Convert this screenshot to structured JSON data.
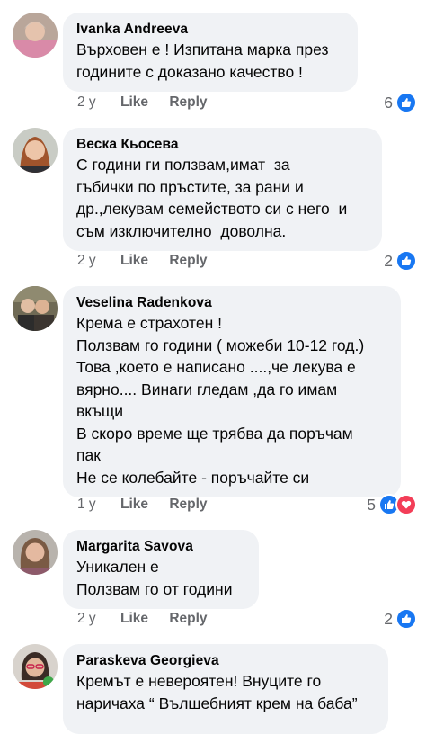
{
  "comments": [
    {
      "author": "Ivanka Andreeva",
      "lines": [
        "Върховен е ! Изпитана марка през",
        "годините с доказано качество !"
      ],
      "time": "2 y",
      "like_label": "Like",
      "reply_label": "Reply",
      "reactions": {
        "count": "6",
        "types": [
          "like"
        ]
      }
    },
    {
      "author": "Веска Кьосева",
      "lines": [
        "С години ги ползвам,имат  за",
        "гъбички по пръстите, за рани и",
        "др.,лекувам семейството си с него  и",
        "съм изключително  доволна."
      ],
      "time": "2 y",
      "like_label": "Like",
      "reply_label": "Reply",
      "reactions": {
        "count": "2",
        "types": [
          "like"
        ]
      }
    },
    {
      "author": "Veselina Radenkova",
      "lines": [
        "Крема е страхотен !",
        "Ползвам го години ( можеби 10-12 год.)",
        "Това ,което е написано ....,че лекува е",
        "вярно.... Винаги гледам ,да го имам",
        "вкъщи",
        "В скоро време ще трябва да поръчам",
        "пак",
        "Не се колебайте - поръчайте си"
      ],
      "time": "1 y",
      "like_label": "Like",
      "reply_label": "Reply",
      "reactions": {
        "count": "5",
        "types": [
          "like",
          "love"
        ]
      }
    },
    {
      "author": "Margarita Savova",
      "lines": [
        "Уникален е",
        "Ползвам го от години"
      ],
      "time": "2 y",
      "like_label": "Like",
      "reply_label": "Reply",
      "reactions": {
        "count": "2",
        "types": [
          "like"
        ]
      }
    },
    {
      "author": "Paraskeva Georgieva",
      "lines": [
        "Кремът е невероятен! Внуците го",
        "наричаха “ Вълшебният крем на баба”"
      ],
      "time": "",
      "like_label": "",
      "reply_label": "",
      "reactions": {
        "count": "",
        "types": []
      }
    }
  ],
  "colors": {
    "bubble": "#f0f2f5",
    "text": "#050505",
    "secondary": "#65676b",
    "like": "#1877f2",
    "love": "#f33e58"
  }
}
